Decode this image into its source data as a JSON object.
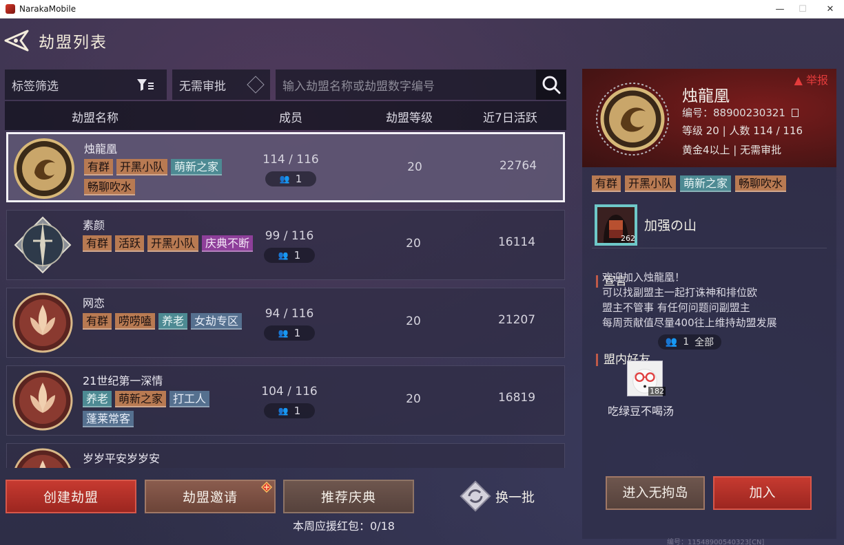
{
  "window": {
    "title": "NarakaMobile",
    "minimize": "—",
    "maximize": "☐",
    "close": "✕"
  },
  "page": {
    "title": "劫盟列表"
  },
  "filters": {
    "tag_filter": "标签筛选",
    "no_approval": "无需审批",
    "search_placeholder": "输入劫盟名称或劫盟数字编号"
  },
  "list": {
    "headers": {
      "name": "劫盟名称",
      "members": "成员",
      "level": "劫盟等级",
      "activity": "近7日活跃"
    },
    "rows": [
      {
        "name": "烛龍凰",
        "tags": [
          {
            "text": "有群",
            "color": "brown"
          },
          {
            "text": "开黑小队",
            "color": "brown"
          },
          {
            "text": "萌新之家",
            "color": "teal"
          },
          {
            "text": "畅聊吹水",
            "color": "brown"
          }
        ],
        "members": "114 / 116",
        "friends": "1",
        "level": "20",
        "activity": "22764",
        "selected": true,
        "emblem": "dragon-gold"
      },
      {
        "name": "素颜",
        "tags": [
          {
            "text": "有群",
            "color": "brown"
          },
          {
            "text": "活跃",
            "color": "brown"
          },
          {
            "text": "开黑小队",
            "color": "brown"
          },
          {
            "text": "庆典不断",
            "color": "purple"
          }
        ],
        "members": "99 / 116",
        "friends": "1",
        "level": "20",
        "activity": "16114",
        "selected": false,
        "emblem": "sword-steel"
      },
      {
        "name": "网恋",
        "tags": [
          {
            "text": "有群",
            "color": "brown"
          },
          {
            "text": "唠唠嗑",
            "color": "brown"
          },
          {
            "text": "养老",
            "color": "teal"
          },
          {
            "text": "女劫专区",
            "color": "blue"
          }
        ],
        "members": "94 / 116",
        "friends": "1",
        "level": "20",
        "activity": "21207",
        "selected": false,
        "emblem": "lotus-red"
      },
      {
        "name": "21世纪第一深情",
        "tags": [
          {
            "text": "养老",
            "color": "teal"
          },
          {
            "text": "萌新之家",
            "color": "brown"
          },
          {
            "text": "打工人",
            "color": "blue"
          },
          {
            "text": "蓬莱常客",
            "color": "blue"
          }
        ],
        "members": "104 / 116",
        "friends": "1",
        "level": "20",
        "activity": "16819",
        "selected": false,
        "emblem": "lotus-red"
      },
      {
        "name": "岁岁平安岁岁安",
        "tags": [],
        "members": "",
        "friends": "",
        "level": "",
        "activity": "",
        "selected": false,
        "emblem": "lotus-red"
      }
    ]
  },
  "actions": {
    "create": "创建劫盟",
    "invite": "劫盟邀请",
    "celebration": "推荐庆典",
    "refresh": "换一批",
    "red_packet": "本周应援红包：0/18"
  },
  "detail": {
    "report": "举报",
    "name": "烛龍凰",
    "id_line": "编号：88900230321",
    "level_line": "等级 20 | 人数 114 / 116",
    "req_line": "黄金4以上 | 无需审批",
    "tags": [
      {
        "text": "有群",
        "color": "brown"
      },
      {
        "text": "开黑小队",
        "color": "brown"
      },
      {
        "text": "萌新之家",
        "color": "teal"
      },
      {
        "text": "畅聊吹水",
        "color": "brown"
      }
    ],
    "leader": {
      "name": "加强の山",
      "level": "262"
    },
    "declaration_title": "宣言",
    "declaration": [
      "欢迎加入烛龍凰！",
      "可以找副盟主一起打诛神和排位欧",
      "盟主不管事 有任何问题问副盟主",
      "每周贡献值尽量400往上维持劫盟发展"
    ],
    "friends_title": "盟内好友",
    "friends_count": "1",
    "friends_all": "全部",
    "friend": {
      "name": "吃绿豆不喝汤",
      "level": "182"
    },
    "enter_island": "进入无拘岛",
    "join": "加入"
  },
  "footer": {
    "id": "编号：11548900540323[CN]"
  },
  "colors": {
    "accent_red": "#c63a30",
    "tag_brown": "#b87a52",
    "tag_teal": "#4d8a93",
    "tag_blue": "#55708f",
    "tag_purple": "#8e3f9a",
    "report_red": "#e33b3b"
  }
}
